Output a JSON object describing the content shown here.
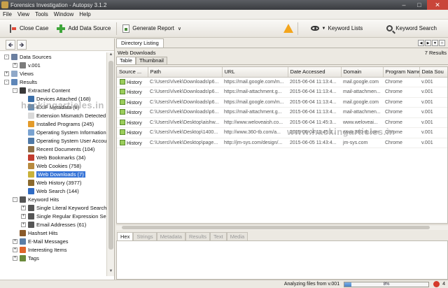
{
  "window": {
    "title": "Forensics Investigation - Autopsy 3.1.2"
  },
  "menu": [
    "File",
    "View",
    "Tools",
    "Window",
    "Help"
  ],
  "toolbar": {
    "close_case": "Close Case",
    "add_data_source": "Add Data Source",
    "generate_report": "Generate Report",
    "keyword_lists": "Keyword Lists",
    "keyword_search": "Keyword Search"
  },
  "tree": [
    {
      "label": "Data Sources",
      "level": 0,
      "toggle": "-",
      "icon": "drive-icon",
      "color": "#6a7fa0"
    },
    {
      "label": "v.001",
      "level": 1,
      "toggle": "+",
      "icon": "disk-icon",
      "color": "#7c7c7c"
    },
    {
      "label": "Views",
      "level": 0,
      "toggle": "+",
      "icon": "views-icon",
      "color": "#8fa8c8"
    },
    {
      "label": "Results",
      "level": 0,
      "toggle": "-",
      "icon": "results-icon",
      "color": "#5e86b8"
    },
    {
      "label": "Extracted Content",
      "level": 1,
      "toggle": "-",
      "icon": "extracted-icon",
      "color": "#3a3a3a"
    },
    {
      "label": "Devices Attached (168)",
      "level": 2,
      "toggle": "",
      "icon": "usb-icon",
      "color": "#3a6ea8"
    },
    {
      "label": "EXIF Metadata (8)",
      "level": 2,
      "toggle": "",
      "icon": "camera-icon",
      "color": "#6b8fb3"
    },
    {
      "label": "Extension Mismatch Detected",
      "level": 2,
      "toggle": "",
      "icon": "mismatch-icon",
      "color": "#d9d9d9"
    },
    {
      "label": "Installed Programs (245)",
      "level": 2,
      "toggle": "",
      "icon": "programs-icon",
      "color": "#e39b2b"
    },
    {
      "label": "Operating System Information",
      "level": 2,
      "toggle": "",
      "icon": "os-icon",
      "color": "#7aa3d1"
    },
    {
      "label": "Operating System User Account",
      "level": 2,
      "toggle": "",
      "icon": "user-icon",
      "color": "#4f79a7"
    },
    {
      "label": "Recent Documents (104)",
      "level": 2,
      "toggle": "",
      "icon": "recent-icon",
      "color": "#8f6f45"
    },
    {
      "label": "Web Bookmarks (34)",
      "level": 2,
      "toggle": "",
      "icon": "bookmark-icon",
      "color": "#c23b2e"
    },
    {
      "label": "Web Cookies (758)",
      "level": 2,
      "toggle": "",
      "icon": "cookie-icon",
      "color": "#b88a3e"
    },
    {
      "label": "Web Downloads (7)",
      "level": 2,
      "toggle": "",
      "icon": "download-icon",
      "color": "#c9b23a",
      "selected": true
    },
    {
      "label": "Web History (3977)",
      "level": 2,
      "toggle": "",
      "icon": "history-icon",
      "color": "#8b6a2e"
    },
    {
      "label": "Web Search (144)",
      "level": 2,
      "toggle": "",
      "icon": "websearch-icon",
      "color": "#2f6bc4"
    },
    {
      "label": "Keyword Hits",
      "level": 1,
      "toggle": "-",
      "icon": "keyword-icon",
      "color": "#555555"
    },
    {
      "label": "Single Literal Keyword Search",
      "level": 2,
      "toggle": "+",
      "icon": "search-icon",
      "color": "#555555"
    },
    {
      "label": "Single Regular Expression Sea",
      "level": 2,
      "toggle": "+",
      "icon": "search-icon",
      "color": "#555555"
    },
    {
      "label": "Email Addresses (61)",
      "level": 2,
      "toggle": "+",
      "icon": "search-icon",
      "color": "#555555"
    },
    {
      "label": "Hashset Hits",
      "level": 1,
      "toggle": "",
      "icon": "hashset-icon",
      "color": "#8a5a2a"
    },
    {
      "label": "E-Mail Messages",
      "level": 1,
      "toggle": "+",
      "icon": "email-icon",
      "color": "#5b7ea6"
    },
    {
      "label": "Interesting Items",
      "level": 1,
      "toggle": "+",
      "icon": "interesting-icon",
      "color": "#e0652b"
    },
    {
      "label": "Tags",
      "level": 1,
      "toggle": "+",
      "icon": "tags-icon",
      "color": "#6b8a3b"
    }
  ],
  "directory": {
    "tab_label": "Directory Listing",
    "title": "Web Downloads",
    "result_count": "7 Results",
    "view_tabs": [
      "Table",
      "Thumbnail"
    ],
    "columns": [
      "Source ...",
      "Path",
      "URL",
      "Date Accessed",
      "Domain",
      "Program Name",
      "Data Sou"
    ],
    "rows": [
      [
        "History",
        "C:\\Users\\Vivek\\Downloads\\p6...",
        "https://mail.google.com/m...",
        "2015-06-04 11:13:4...",
        "mail.google.com",
        "Chrome",
        "v.001"
      ],
      [
        "History",
        "C:\\Users\\Vivek\\Downloads\\p6...",
        "https://mail-attachment.g...",
        "2015-06-04 11:13:4...",
        "mail-attachmen...",
        "Chrome",
        "v.001"
      ],
      [
        "History",
        "C:\\Users\\Vivek\\Downloads\\p6...",
        "https://mail.google.com/m...",
        "2015-06-04 11:13:4...",
        "mail.google.com",
        "Chrome",
        "v.001"
      ],
      [
        "History",
        "C:\\Users\\Vivek\\Downloads\\p6...",
        "https://mail-attachment.g...",
        "2015-06-04 11:13:4...",
        "mail-attachmen...",
        "Chrome",
        "v.001"
      ],
      [
        "History",
        "C:\\Users\\Vivek\\Desktop\\aishw...",
        "http://www.weloveaish.co...",
        "2015-06-04 11:45:3...",
        "www.weloveai...",
        "Chrome",
        "v.001"
      ],
      [
        "History",
        "C:\\Users\\Vivek\\Desktop\\1400...",
        "http://www.360-tb.com/a...",
        "2015-06-04 11:45:3...",
        "www.360-tb.com",
        "Chrome",
        "v.001"
      ],
      [
        "History",
        "C:\\Users\\Vivek\\Desktop\\page...",
        "http://jm-sys.com/design/...",
        "2015-06-05 11:43:4...",
        "jm-sys.com",
        "Chrome",
        "v.001"
      ]
    ],
    "content_tabs": [
      "Hex",
      "Strings",
      "Metadata",
      "Results",
      "Text",
      "Media"
    ]
  },
  "status": {
    "text": "Analyzing files from v.001",
    "progress_pct": 8,
    "progress_label": "8%",
    "error_count": "4"
  },
  "watermarks": [
    "hackingarticles.in",
    "www.hackingarticles.in"
  ]
}
